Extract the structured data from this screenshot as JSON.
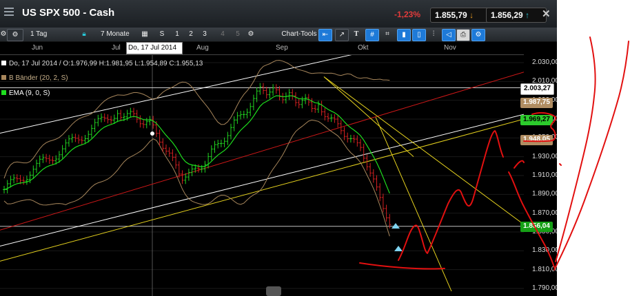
{
  "window": {
    "title": "US SPX 500 - Cash",
    "change": "-1,23%",
    "sell_price": "1.855,79",
    "buy_price": "1.856,29",
    "sell_arrow": "↓",
    "buy_arrow": "↑",
    "close": "✕"
  },
  "toolbar": {
    "interval": "1 Tag",
    "range": "7 Monate",
    "calendar_icon": "▦",
    "s_label": "S",
    "nums": [
      "1",
      "2",
      "3",
      "4",
      "5"
    ],
    "chart_tools": "Chart-Tools",
    "text_tool": "T",
    "grid_tool": "#"
  },
  "time_axis": {
    "months": [
      "Jun",
      "Jul",
      "Aug",
      "Sep",
      "Okt",
      "Nov"
    ],
    "hover_date": "Do, 17 Jul 2014"
  },
  "legend": {
    "ohlc": "Do, 17 Jul 2014 / O:1.976,99  H:1.981,95  L:1.954,89  C:1.955,13",
    "bollinger": "B Bänder (20, 2, S)",
    "ema": "EMA (9, 0, S)"
  },
  "price_axis": {
    "ticks": [
      "2.030,00",
      "2.010,00",
      "1.990,00",
      "1.970,00",
      "1.950,00",
      "1.930,00",
      "1.910,00",
      "1.890,00",
      "1.870,00",
      "1.850,00",
      "1.830,00",
      "1.810,00",
      "1.790,00"
    ],
    "tick_values": [
      2030,
      2010,
      1990,
      1970,
      1950,
      1930,
      1910,
      1890,
      1870,
      1850,
      1830,
      1810,
      1790
    ],
    "labels": [
      {
        "text": "2.003,27",
        "value": 2003.27,
        "style": "white"
      },
      {
        "text": "1.987,75",
        "value": 1987.75,
        "style": "tan"
      },
      {
        "text": "1.969,27",
        "value": 1969.27,
        "style": "green"
      },
      {
        "text": "1.948,05",
        "value": 1948.05,
        "style": "tan"
      },
      {
        "text": "1.856,04",
        "value": 1856.04,
        "style": "green2"
      }
    ]
  },
  "colors": {
    "up": "#21d421",
    "down": "#d42121",
    "ema": "#1ede1e",
    "bands": "#a8875c",
    "channel_white": "#ffffff",
    "channel_red": "#d01818",
    "channel_yellow": "#e6d21e",
    "drawing_red": "#e21010"
  }
}
